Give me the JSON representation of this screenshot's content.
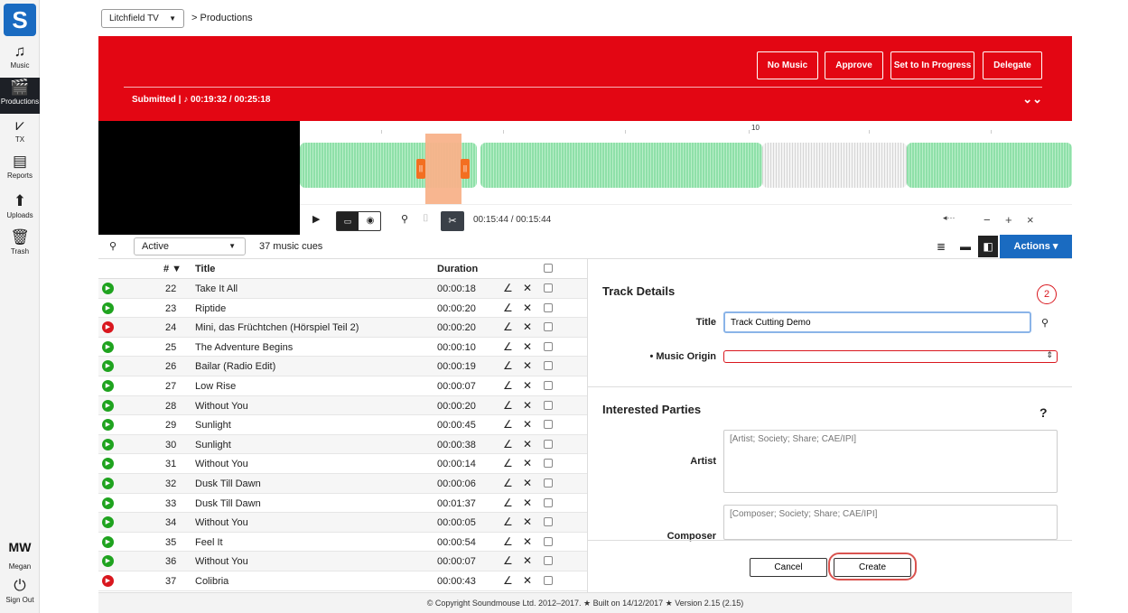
{
  "sidebar": {
    "logo": "S",
    "items": [
      {
        "label": "Music",
        "icon": "♫"
      },
      {
        "label": "Productions",
        "icon": "🎬"
      },
      {
        "label": "TX",
        "icon": "⩗"
      },
      {
        "label": "Reports",
        "icon": "▤"
      },
      {
        "label": "Uploads",
        "icon": "⬆"
      },
      {
        "label": "Trash",
        "icon": "🗑"
      }
    ],
    "user_initials": "MW",
    "user_name": "Megan",
    "sign_out": "Sign Out"
  },
  "breadcrumb": {
    "channel": "Litchfield TV",
    "path": "> Productions"
  },
  "header": {
    "buttons": {
      "no_music": "No Music",
      "approve": "Approve",
      "in_progress": "Set to In Progress",
      "delegate": "Delegate"
    },
    "status": "Submitted | ♪ 00:19:32 / 00:25:18",
    "accent": "#e30613"
  },
  "waveform": {
    "ruler_label": "10",
    "time": "00:15:44 / 00:15:44"
  },
  "filter": {
    "status": "Active",
    "count": "37 music cues",
    "actions": "Actions ▾"
  },
  "table": {
    "headers": {
      "num": "# ▼",
      "title": "Title",
      "duration": "Duration"
    },
    "rows": [
      {
        "num": "22",
        "title": "Take It All",
        "duration": "00:00:18",
        "status": "green"
      },
      {
        "num": "23",
        "title": "Riptide",
        "duration": "00:00:20",
        "status": "green"
      },
      {
        "num": "24",
        "title": "Mini, das Früchtchen (Hörspiel Teil 2)",
        "duration": "00:00:20",
        "status": "red"
      },
      {
        "num": "25",
        "title": "The Adventure Begins",
        "duration": "00:00:10",
        "status": "green"
      },
      {
        "num": "26",
        "title": "Bailar (Radio Edit)",
        "duration": "00:00:19",
        "status": "green"
      },
      {
        "num": "27",
        "title": "Low Rise",
        "duration": "00:00:07",
        "status": "green"
      },
      {
        "num": "28",
        "title": "Without You",
        "duration": "00:00:20",
        "status": "green"
      },
      {
        "num": "29",
        "title": "Sunlight",
        "duration": "00:00:45",
        "status": "green"
      },
      {
        "num": "30",
        "title": "Sunlight",
        "duration": "00:00:38",
        "status": "green"
      },
      {
        "num": "31",
        "title": "Without You",
        "duration": "00:00:14",
        "status": "green"
      },
      {
        "num": "32",
        "title": "Dusk Till Dawn",
        "duration": "00:00:06",
        "status": "green"
      },
      {
        "num": "33",
        "title": "Dusk Till Dawn",
        "duration": "00:01:37",
        "status": "green"
      },
      {
        "num": "34",
        "title": "Without You",
        "duration": "00:00:05",
        "status": "green"
      },
      {
        "num": "35",
        "title": "Feel It",
        "duration": "00:00:54",
        "status": "green"
      },
      {
        "num": "36",
        "title": "Without You",
        "duration": "00:00:07",
        "status": "green"
      },
      {
        "num": "37",
        "title": "Colibria",
        "duration": "00:00:43",
        "status": "red"
      }
    ]
  },
  "details": {
    "heading": "Track Details",
    "badge": "2",
    "title_label": "Title",
    "title_value": "Track Cutting Demo",
    "origin_label": "• Music Origin",
    "parties_heading": "Interested Parties",
    "help": "?",
    "artist_label": "Artist",
    "artist_placeholder": "[Artist; Society; Share; CAE/IPI]",
    "composer_label": "Composer",
    "composer_placeholder": "[Composer; Society; Share; CAE/IPI]",
    "cancel": "Cancel",
    "create": "Create"
  },
  "footer": "© Copyright Soundmouse Ltd. 2012–2017. ★ Built on 14/12/2017 ★ Version 2.15 (2.15)"
}
